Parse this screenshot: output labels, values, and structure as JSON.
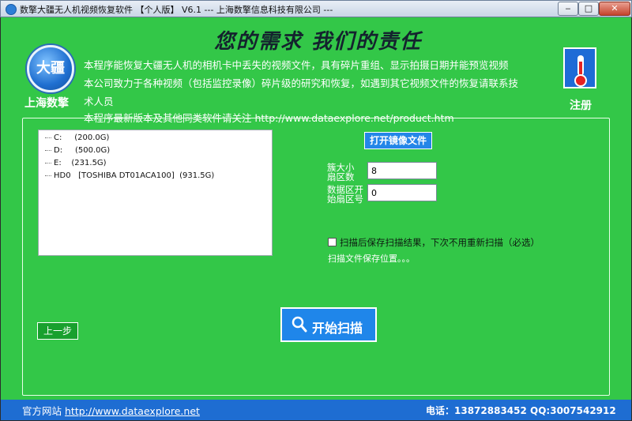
{
  "window": {
    "title": "数擎大疆无人机视频恢复软件 【个人版】 V6.1 --- 上海数擎信息科技有限公司 ---",
    "minimize": "‒",
    "maximize": "□",
    "close": "✕"
  },
  "header": {
    "slogan": "您的需求   我们的责任",
    "logo_text": "大疆",
    "brand": "上海数擎",
    "description": [
      "本程序能恢复大疆无人机的相机卡中丢失的视频文件，具有碎片重组、显示拍摄日期并能预览视频",
      "本公司致力于各种视频（包括监控录像）碎片级的研究和恢复，如遇到其它视频文件的恢复请联系技",
      "术人员",
      "本程序最新版本及其他同类软件请关注 http://www.dataexplore.net/product.htm"
    ],
    "register": "注册"
  },
  "drives": [
    {
      "name": "C:",
      "size": "(200.0G)"
    },
    {
      "name": "D:",
      "size": "(500.0G)"
    },
    {
      "name": "E:",
      "size": "(231.5G)"
    },
    {
      "name": "HD0",
      "size": "[TOSHIBA DT01ACA100]  (931.5G)"
    }
  ],
  "controls": {
    "open_image": "打开镜像文件",
    "cluster_size_label": "簇大小\n扇区数",
    "cluster_size_value": "8",
    "data_start_label": "数据区开\n始扇区号",
    "data_start_value": "0",
    "save_results_label": "扫描后保存扫描结果，下次不用重新扫描（必选）",
    "save_location": "扫描文件保存位置。。。",
    "back": "上一步",
    "start_scan": "开始扫描"
  },
  "footer": {
    "website_label": "官方网站",
    "website_url": "http://www.dataexplore.net",
    "contact": "电话：13872883452 QQ:3007542912"
  },
  "colors": {
    "background_green": "#33c748",
    "button_blue": "#1f86ea",
    "footer_blue": "#1e6dd2"
  }
}
